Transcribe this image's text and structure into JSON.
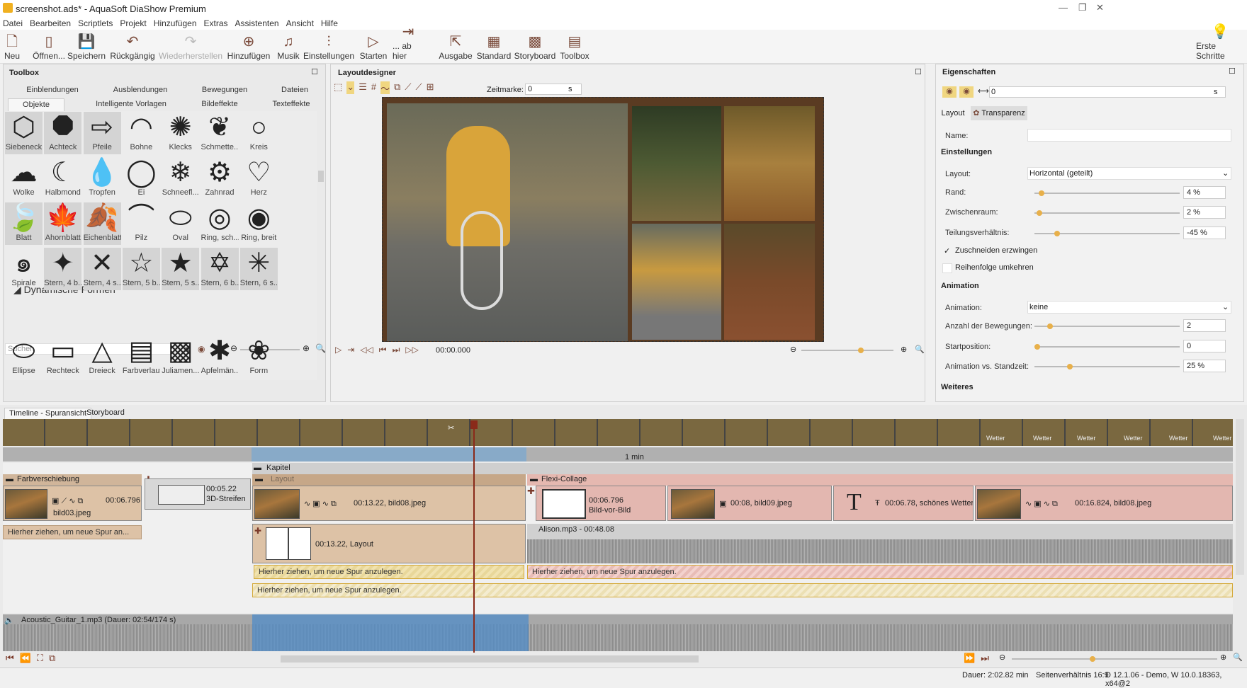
{
  "window": {
    "title": "screenshot.ads* - AquaSoft DiaShow Premium"
  },
  "menu": [
    "Datei",
    "Bearbeiten",
    "Scriptlets",
    "Projekt",
    "Hinzufügen",
    "Extras",
    "Assistenten",
    "Ansicht",
    "Hilfe"
  ],
  "toolbar": {
    "neu": "Neu",
    "oeffnen": "Öffnen...",
    "speichern": "Speichern",
    "rueck": "Rückgängig",
    "wieder": "Wiederherstellen",
    "hinzufuegen": "Hinzufügen",
    "musik": "Musik",
    "einstellungen": "Einstellungen",
    "starten": "Starten",
    "abhier": "... ab hier",
    "ausgabe": "Ausgabe",
    "standard": "Standard",
    "storyboard": "Storyboard",
    "toolbox": "Toolbox",
    "erste": "Erste Schritte"
  },
  "toolbox": {
    "title": "Toolbox",
    "tabs_row1": [
      "Einblendungen",
      "Ausblendungen",
      "Bewegungen",
      "Dateien"
    ],
    "tabs_row2": [
      "Objekte",
      "Intelligente Vorlagen",
      "Bildeffekte",
      "Texteffekte"
    ],
    "shapes": [
      [
        "Siebeneck",
        "Achteck",
        "Pfeile",
        "Bohne",
        "Klecks",
        "Schmette...",
        "Kreis"
      ],
      [
        "Wolke",
        "Halbmond",
        "Tropfen",
        "Ei",
        "Schneefl...",
        "Zahnrad",
        "Herz"
      ],
      [
        "Blatt",
        "Ahornblatt",
        "Eichenblatt",
        "Pilz",
        "Oval",
        "Ring, sch...",
        "Ring, breit"
      ],
      [
        "Spirale",
        "Stern, 4 b...",
        "Stern, 4 s...",
        "Stern, 5 b...",
        "Stern, 5 s...",
        "Stern, 6 b...",
        "Stern, 6 s..."
      ]
    ],
    "section": "Dynamische Formen",
    "dyn": [
      "Ellipse",
      "Rechteck",
      "Dreieck",
      "Farbverlauf",
      "Juliamen...",
      "Apfelmän...",
      "Form"
    ],
    "search_placeholder": "Suchen"
  },
  "layout": {
    "title": "Layoutdesigner",
    "zeitmarke_label": "Zeitmarke:",
    "zeitmarke_value": "0",
    "unit": "s",
    "time": "00:00.000"
  },
  "props": {
    "title": "Eigenschaften",
    "top_value": "0",
    "unit": "s",
    "tabs": [
      "Layout",
      "Transparenz"
    ],
    "name_label": "Name:",
    "einstellungen": "Einstellungen",
    "layout_label": "Layout:",
    "layout_value": "Horizontal (geteilt)",
    "rand_label": "Rand:",
    "rand_value": "4 %",
    "zw_label": "Zwischenraum:",
    "zw_value": "2 %",
    "teil_label": "Teilungsverhältnis:",
    "teil_value": "-45 %",
    "zuschneiden": "Zuschneiden erzwingen",
    "reihenfolge": "Reihenfolge umkehren",
    "animation": "Animation",
    "anim_label": "Animation:",
    "anim_value": "keine",
    "anzahl_label": "Anzahl der Bewegungen:",
    "anzahl_value": "2",
    "start_label": "Startposition:",
    "start_value": "0",
    "avs_label": "Animation vs. Standzeit:",
    "avs_value": "25 %",
    "weiteres": "Weiteres"
  },
  "timeline": {
    "tabs": [
      "Timeline - Spuransicht",
      "Storyboard"
    ],
    "ruler_mark": "1 min",
    "kapitel": "Kapitel",
    "layout_bar": "Layout",
    "flexi": "Flexi-Collage",
    "farbverschiebung": "Farbverschiebung",
    "clip1_time": "00:06.796",
    "clip1_name": "bild03.jpeg",
    "streifen_time": "00:05.22",
    "streifen_name": "3D-Streifen",
    "layclip_time": "00:13.22, bild08.jpeg",
    "bvb_time": "00:06.796",
    "bvb_name": "Bild-vor-Bild",
    "b09": "00:08, bild09.jpeg",
    "text": "00:06.78, schönes Wetter",
    "b08b": "00:16.824, bild08.jpeg",
    "layout2": "00:13.22, Layout",
    "alison": "Alison.mp3 - 00:48.08",
    "hint": "Hierher ziehen, um neue Spur anzulegen.",
    "hint_short": "Hierher ziehen, um neue Spur an...",
    "audio": "Acoustic_Guitar_1.mp3 (Dauer: 02:54/174 s)",
    "thumb_text": "Wetter"
  },
  "status": {
    "dauer": "Dauer: 2:02.82 min",
    "seiten": "Seitenverhältnis 16:9",
    "version": "D 12.1.06 - Demo, W 10.0.18363, x64@2"
  },
  "colors": {
    "accent": "#7a4a3a",
    "knob": "#e8b04a",
    "tan": "#ddc2a6",
    "pink": "#e3b7b0",
    "playhead": "#8a2a1a"
  }
}
